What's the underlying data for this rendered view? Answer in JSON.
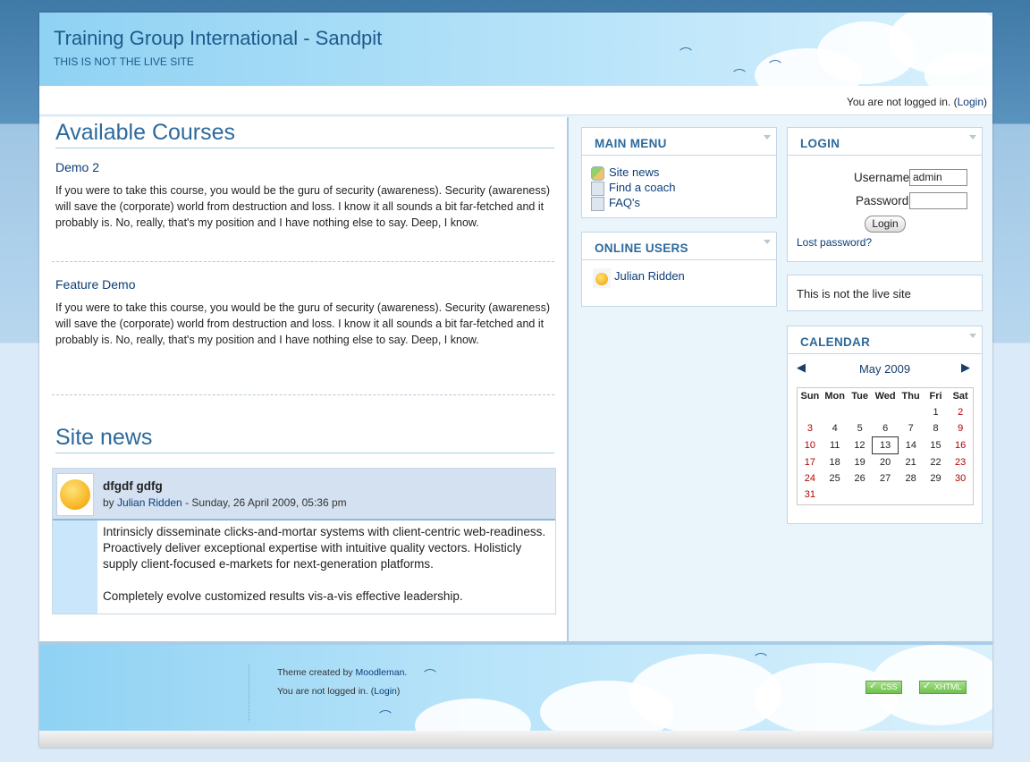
{
  "header": {
    "site_title": "Training Group International - Sandpit",
    "subtitle": "THIS IS NOT THE LIVE SITE"
  },
  "loginbar": {
    "prefix": "You are not logged in. (",
    "login_link": "Login",
    "suffix": ")"
  },
  "available_courses": {
    "heading": "Available Courses",
    "courses": [
      {
        "name": "Demo 2",
        "summary": "If you were to take this course, you would be the guru of security (awareness). Security (awareness) will save the (corporate) world from destruction and loss. I know it all sounds a bit far-fetched and it probably is. No, really, that's my position and I have nothing else to say. Deep, I know."
      },
      {
        "name": "Feature Demo",
        "summary": "If you were to take this course, you would be the guru of security (awareness). Security (awareness) will save the (corporate) world from destruction and loss. I know it all sounds a bit far-fetched and it probably is. No, really, that's my position and I have nothing else to say. Deep, I know."
      }
    ]
  },
  "site_news": {
    "heading": "Site news",
    "post": {
      "subject": "dfgdf gdfg",
      "by_prefix": "by ",
      "author": "Julian Ridden",
      "date": " - Sunday, 26 April 2009, 05:36 pm",
      "paragraph1": "Intrinsicly disseminate clicks-and-mortar systems with client-centric web-readiness. Proactively deliver exceptional expertise with intuitive quality vectors. Holisticly supply client-focused e-markets for next-generation platforms.",
      "paragraph2": "Completely evolve customized results vis-a-vis effective leadership."
    }
  },
  "main_menu": {
    "title": "MAIN MENU",
    "items": [
      {
        "label": "Site news",
        "icon": "forum-icon"
      },
      {
        "label": "Find a coach",
        "icon": "resource-icon"
      },
      {
        "label": "FAQ's",
        "icon": "resource-icon"
      }
    ]
  },
  "online_users": {
    "title": "ONLINE USERS",
    "users": [
      "Julian Ridden"
    ]
  },
  "login_block": {
    "title": "LOGIN",
    "username_label": "Username",
    "username_value": "admin",
    "password_label": "Password",
    "password_value": "",
    "button": "Login",
    "lost_password": "Lost password?"
  },
  "notice_block": {
    "text": "This is not the live site"
  },
  "calendar": {
    "title": "CALENDAR",
    "month": "May 2009",
    "prev": "◀",
    "next": "▶",
    "weekdays": [
      "Sun",
      "Mon",
      "Tue",
      "Wed",
      "Thu",
      "Fri",
      "Sat"
    ],
    "weeks": [
      [
        "",
        "",
        "",
        "",
        "",
        "1",
        "2"
      ],
      [
        "3",
        "4",
        "5",
        "6",
        "7",
        "8",
        "9"
      ],
      [
        "10",
        "11",
        "12",
        "13",
        "14",
        "15",
        "16"
      ],
      [
        "17",
        "18",
        "19",
        "20",
        "21",
        "22",
        "23"
      ],
      [
        "24",
        "25",
        "26",
        "27",
        "28",
        "29",
        "30"
      ],
      [
        "31",
        "",
        "",
        "",
        "",
        "",
        ""
      ]
    ],
    "today": "13"
  },
  "footer": {
    "theme_prefix": "Theme created by ",
    "theme_author": "Moodleman",
    "theme_suffix": ".",
    "login_prefix": "You are not logged in. (",
    "login_link": "Login",
    "login_suffix": ")",
    "css_badge": "CSS",
    "xhtml_badge": "XHTML"
  },
  "colors": {
    "accent": "#2d6a9c",
    "link": "#0b3d7a",
    "weekend": "#b30000"
  }
}
